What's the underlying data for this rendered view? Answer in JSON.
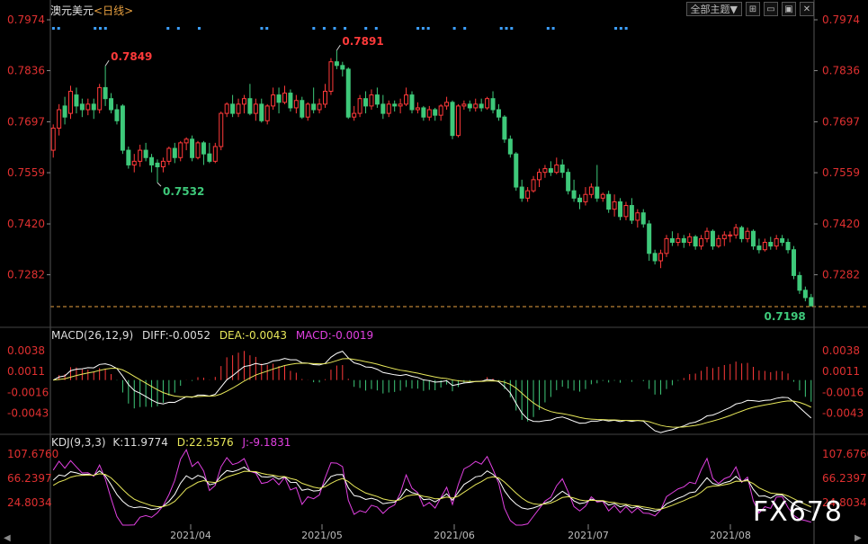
{
  "header": {
    "symbol": "澳元美元",
    "period": "<日线>",
    "theme_button": "全部主题▼"
  },
  "watermark": "FX678",
  "colors": {
    "up": "#ff3a3a",
    "down": "#3ec97a",
    "axis_text": "#e03030",
    "diff": "#ffffff",
    "dea": "#e8e85a",
    "j": "#e040e0",
    "marker": "#3da0ff",
    "last_price_line": "#e8a040"
  },
  "chart_data": [
    {
      "type": "candlestick",
      "title": "澳元美元<日线>",
      "ylim": [
        0.7198,
        0.7974
      ],
      "yticks": [
        "0.7974",
        "0.7836",
        "0.7697",
        "0.7559",
        "0.7420",
        "0.7282"
      ],
      "xticks": [
        "2021/04",
        "2021/05",
        "2021/06",
        "2021/07",
        "2021/08"
      ],
      "annotations": [
        {
          "label": "0.7849",
          "value": 0.7849,
          "kind": "high"
        },
        {
          "label": "0.7532",
          "value": 0.7532,
          "kind": "low"
        },
        {
          "label": "0.7891",
          "value": 0.7891,
          "kind": "high"
        },
        {
          "label": "0.7198",
          "value": 0.7198,
          "kind": "last"
        }
      ],
      "candles": [
        [
          0.762,
          0.768,
          0.76,
          0.769
        ],
        [
          0.768,
          0.773,
          0.766,
          0.7745
        ],
        [
          0.774,
          0.771,
          0.769,
          0.7765
        ],
        [
          0.772,
          0.778,
          0.7705,
          0.7795
        ],
        [
          0.777,
          0.774,
          0.772,
          0.779
        ],
        [
          0.7745,
          0.773,
          0.771,
          0.776
        ],
        [
          0.773,
          0.7745,
          0.7715,
          0.776
        ],
        [
          0.7745,
          0.773,
          0.7705,
          0.776
        ],
        [
          0.773,
          0.779,
          0.772,
          0.78
        ],
        [
          0.779,
          0.776,
          0.774,
          0.7849
        ],
        [
          0.776,
          0.773,
          0.772,
          0.7775
        ],
        [
          0.773,
          0.77,
          0.769,
          0.7745
        ],
        [
          0.774,
          0.762,
          0.761,
          0.7745
        ],
        [
          0.762,
          0.758,
          0.757,
          0.763
        ],
        [
          0.758,
          0.759,
          0.756,
          0.761
        ],
        [
          0.759,
          0.762,
          0.7575,
          0.7635
        ],
        [
          0.762,
          0.76,
          0.759,
          0.764
        ],
        [
          0.76,
          0.758,
          0.756,
          0.761
        ],
        [
          0.7585,
          0.7575,
          0.7532,
          0.7595
        ],
        [
          0.7575,
          0.759,
          0.756,
          0.76
        ],
        [
          0.759,
          0.7625,
          0.758,
          0.763
        ],
        [
          0.7625,
          0.76,
          0.7585,
          0.764
        ],
        [
          0.76,
          0.764,
          0.759,
          0.7645
        ],
        [
          0.764,
          0.765,
          0.762,
          0.7655
        ],
        [
          0.765,
          0.76,
          0.759,
          0.766
        ],
        [
          0.76,
          0.764,
          0.7595,
          0.7645
        ],
        [
          0.764,
          0.761,
          0.758,
          0.7645
        ],
        [
          0.761,
          0.759,
          0.7585,
          0.764
        ],
        [
          0.759,
          0.763,
          0.7585,
          0.764
        ],
        [
          0.763,
          0.772,
          0.762,
          0.7725
        ],
        [
          0.772,
          0.7745,
          0.771,
          0.775
        ],
        [
          0.7745,
          0.772,
          0.771,
          0.777
        ],
        [
          0.772,
          0.7745,
          0.771,
          0.776
        ],
        [
          0.7745,
          0.776,
          0.772,
          0.777
        ],
        [
          0.776,
          0.772,
          0.7715,
          0.78
        ],
        [
          0.772,
          0.7745,
          0.77,
          0.776
        ],
        [
          0.7745,
          0.77,
          0.7695,
          0.776
        ],
        [
          0.77,
          0.774,
          0.769,
          0.7745
        ],
        [
          0.774,
          0.777,
          0.773,
          0.779
        ],
        [
          0.777,
          0.775,
          0.772,
          0.779
        ],
        [
          0.775,
          0.7775,
          0.7745,
          0.7795
        ],
        [
          0.7775,
          0.7735,
          0.7725,
          0.7785
        ],
        [
          0.7735,
          0.7755,
          0.772,
          0.777
        ],
        [
          0.7755,
          0.771,
          0.7705,
          0.7765
        ],
        [
          0.771,
          0.7745,
          0.77,
          0.775
        ],
        [
          0.7745,
          0.773,
          0.772,
          0.779
        ],
        [
          0.773,
          0.7745,
          0.772,
          0.776
        ],
        [
          0.7745,
          0.778,
          0.7735,
          0.78
        ],
        [
          0.778,
          0.786,
          0.777,
          0.787
        ],
        [
          0.786,
          0.785,
          0.784,
          0.7891
        ],
        [
          0.785,
          0.784,
          0.782,
          0.786
        ],
        [
          0.784,
          0.771,
          0.7705,
          0.7845
        ],
        [
          0.771,
          0.772,
          0.77,
          0.774
        ],
        [
          0.772,
          0.776,
          0.771,
          0.777
        ],
        [
          0.776,
          0.774,
          0.772,
          0.778
        ],
        [
          0.774,
          0.777,
          0.773,
          0.7785
        ],
        [
          0.777,
          0.7745,
          0.7735,
          0.779
        ],
        [
          0.7745,
          0.772,
          0.7705,
          0.777
        ],
        [
          0.772,
          0.7745,
          0.771,
          0.7755
        ],
        [
          0.7745,
          0.774,
          0.7725,
          0.7755
        ],
        [
          0.774,
          0.7745,
          0.772,
          0.776
        ],
        [
          0.7745,
          0.777,
          0.774,
          0.779
        ],
        [
          0.777,
          0.773,
          0.772,
          0.778
        ],
        [
          0.773,
          0.7735,
          0.772,
          0.775
        ],
        [
          0.7735,
          0.771,
          0.77,
          0.774
        ],
        [
          0.771,
          0.773,
          0.77,
          0.774
        ],
        [
          0.773,
          0.7715,
          0.77,
          0.7735
        ],
        [
          0.7715,
          0.774,
          0.77,
          0.7745
        ],
        [
          0.774,
          0.775,
          0.773,
          0.7765
        ],
        [
          0.775,
          0.766,
          0.765,
          0.7755
        ],
        [
          0.766,
          0.774,
          0.7655,
          0.7745
        ],
        [
          0.774,
          0.7745,
          0.773,
          0.7755
        ],
        [
          0.7745,
          0.7735,
          0.7725,
          0.7755
        ],
        [
          0.7735,
          0.7745,
          0.7725,
          0.776
        ],
        [
          0.7745,
          0.7735,
          0.7725,
          0.776
        ],
        [
          0.7735,
          0.776,
          0.773,
          0.7765
        ],
        [
          0.776,
          0.773,
          0.772,
          0.778
        ],
        [
          0.773,
          0.771,
          0.77,
          0.7745
        ],
        [
          0.771,
          0.765,
          0.764,
          0.7715
        ],
        [
          0.765,
          0.761,
          0.76,
          0.766
        ],
        [
          0.761,
          0.752,
          0.751,
          0.7615
        ],
        [
          0.752,
          0.749,
          0.748,
          0.754
        ],
        [
          0.749,
          0.751,
          0.748,
          0.752
        ],
        [
          0.751,
          0.754,
          0.7505,
          0.755
        ],
        [
          0.754,
          0.756,
          0.752,
          0.757
        ],
        [
          0.756,
          0.757,
          0.7545,
          0.758
        ],
        [
          0.757,
          0.756,
          0.755,
          0.759
        ],
        [
          0.756,
          0.758,
          0.7555,
          0.76
        ],
        [
          0.758,
          0.756,
          0.7545,
          0.7595
        ],
        [
          0.756,
          0.751,
          0.75,
          0.757
        ],
        [
          0.751,
          0.749,
          0.748,
          0.754
        ],
        [
          0.749,
          0.748,
          0.746,
          0.75
        ],
        [
          0.748,
          0.75,
          0.747,
          0.752
        ],
        [
          0.75,
          0.752,
          0.749,
          0.753
        ],
        [
          0.752,
          0.749,
          0.748,
          0.758
        ],
        [
          0.749,
          0.75,
          0.748,
          0.7505
        ],
        [
          0.75,
          0.746,
          0.745,
          0.751
        ],
        [
          0.746,
          0.748,
          0.744,
          0.75
        ],
        [
          0.748,
          0.744,
          0.743,
          0.749
        ],
        [
          0.744,
          0.747,
          0.743,
          0.748
        ],
        [
          0.747,
          0.743,
          0.742,
          0.749
        ],
        [
          0.743,
          0.745,
          0.741,
          0.746
        ],
        [
          0.745,
          0.742,
          0.741,
          0.746
        ],
        [
          0.742,
          0.734,
          0.732,
          0.743
        ],
        [
          0.734,
          0.732,
          0.731,
          0.735
        ],
        [
          0.732,
          0.734,
          0.73,
          0.735
        ],
        [
          0.734,
          0.738,
          0.733,
          0.739
        ],
        [
          0.738,
          0.737,
          0.736,
          0.74
        ],
        [
          0.737,
          0.738,
          0.736,
          0.7395
        ],
        [
          0.738,
          0.737,
          0.7355,
          0.739
        ],
        [
          0.737,
          0.7385,
          0.736,
          0.7395
        ],
        [
          0.7385,
          0.736,
          0.735,
          0.739
        ],
        [
          0.736,
          0.738,
          0.735,
          0.739
        ],
        [
          0.738,
          0.74,
          0.737,
          0.741
        ],
        [
          0.74,
          0.736,
          0.735,
          0.7405
        ],
        [
          0.736,
          0.738,
          0.7355,
          0.739
        ],
        [
          0.738,
          0.739,
          0.736,
          0.74
        ],
        [
          0.739,
          0.739,
          0.737,
          0.74
        ],
        [
          0.739,
          0.741,
          0.738,
          0.742
        ],
        [
          0.741,
          0.738,
          0.737,
          0.7415
        ],
        [
          0.738,
          0.74,
          0.737,
          0.741
        ],
        [
          0.74,
          0.736,
          0.735,
          0.7405
        ],
        [
          0.736,
          0.735,
          0.734,
          0.738
        ],
        [
          0.735,
          0.737,
          0.7345,
          0.738
        ],
        [
          0.737,
          0.736,
          0.735,
          0.7385
        ],
        [
          0.736,
          0.738,
          0.735,
          0.739
        ],
        [
          0.738,
          0.737,
          0.736,
          0.739
        ],
        [
          0.737,
          0.735,
          0.734,
          0.738
        ],
        [
          0.735,
          0.728,
          0.727,
          0.736
        ],
        [
          0.728,
          0.724,
          0.723,
          0.729
        ],
        [
          0.724,
          0.722,
          0.721,
          0.725
        ],
        [
          0.722,
          0.7198,
          0.7195,
          0.723
        ]
      ]
    },
    {
      "type": "line",
      "title": "MACD(26,12,9)",
      "diff_label": "DIFF:-0.0052",
      "dea_label": "DEA:-0.0043",
      "macd_label": "MACD:-0.0019",
      "yticks": [
        "0.0038",
        "0.0011",
        "-0.0016",
        "-0.0043"
      ],
      "ylim": [
        -0.0055,
        0.0045
      ]
    },
    {
      "type": "line",
      "title": "KDJ(9,3,3)",
      "k_label": "K:11.9774",
      "d_label": "D:22.5576",
      "j_label": "J:-9.1831",
      "yticks": [
        "107.6760",
        "66.2397",
        "24.8034"
      ],
      "ylim": [
        -10,
        115
      ]
    }
  ],
  "scroll": {
    "left_arrow": "◀",
    "right_arrow": "▶"
  }
}
